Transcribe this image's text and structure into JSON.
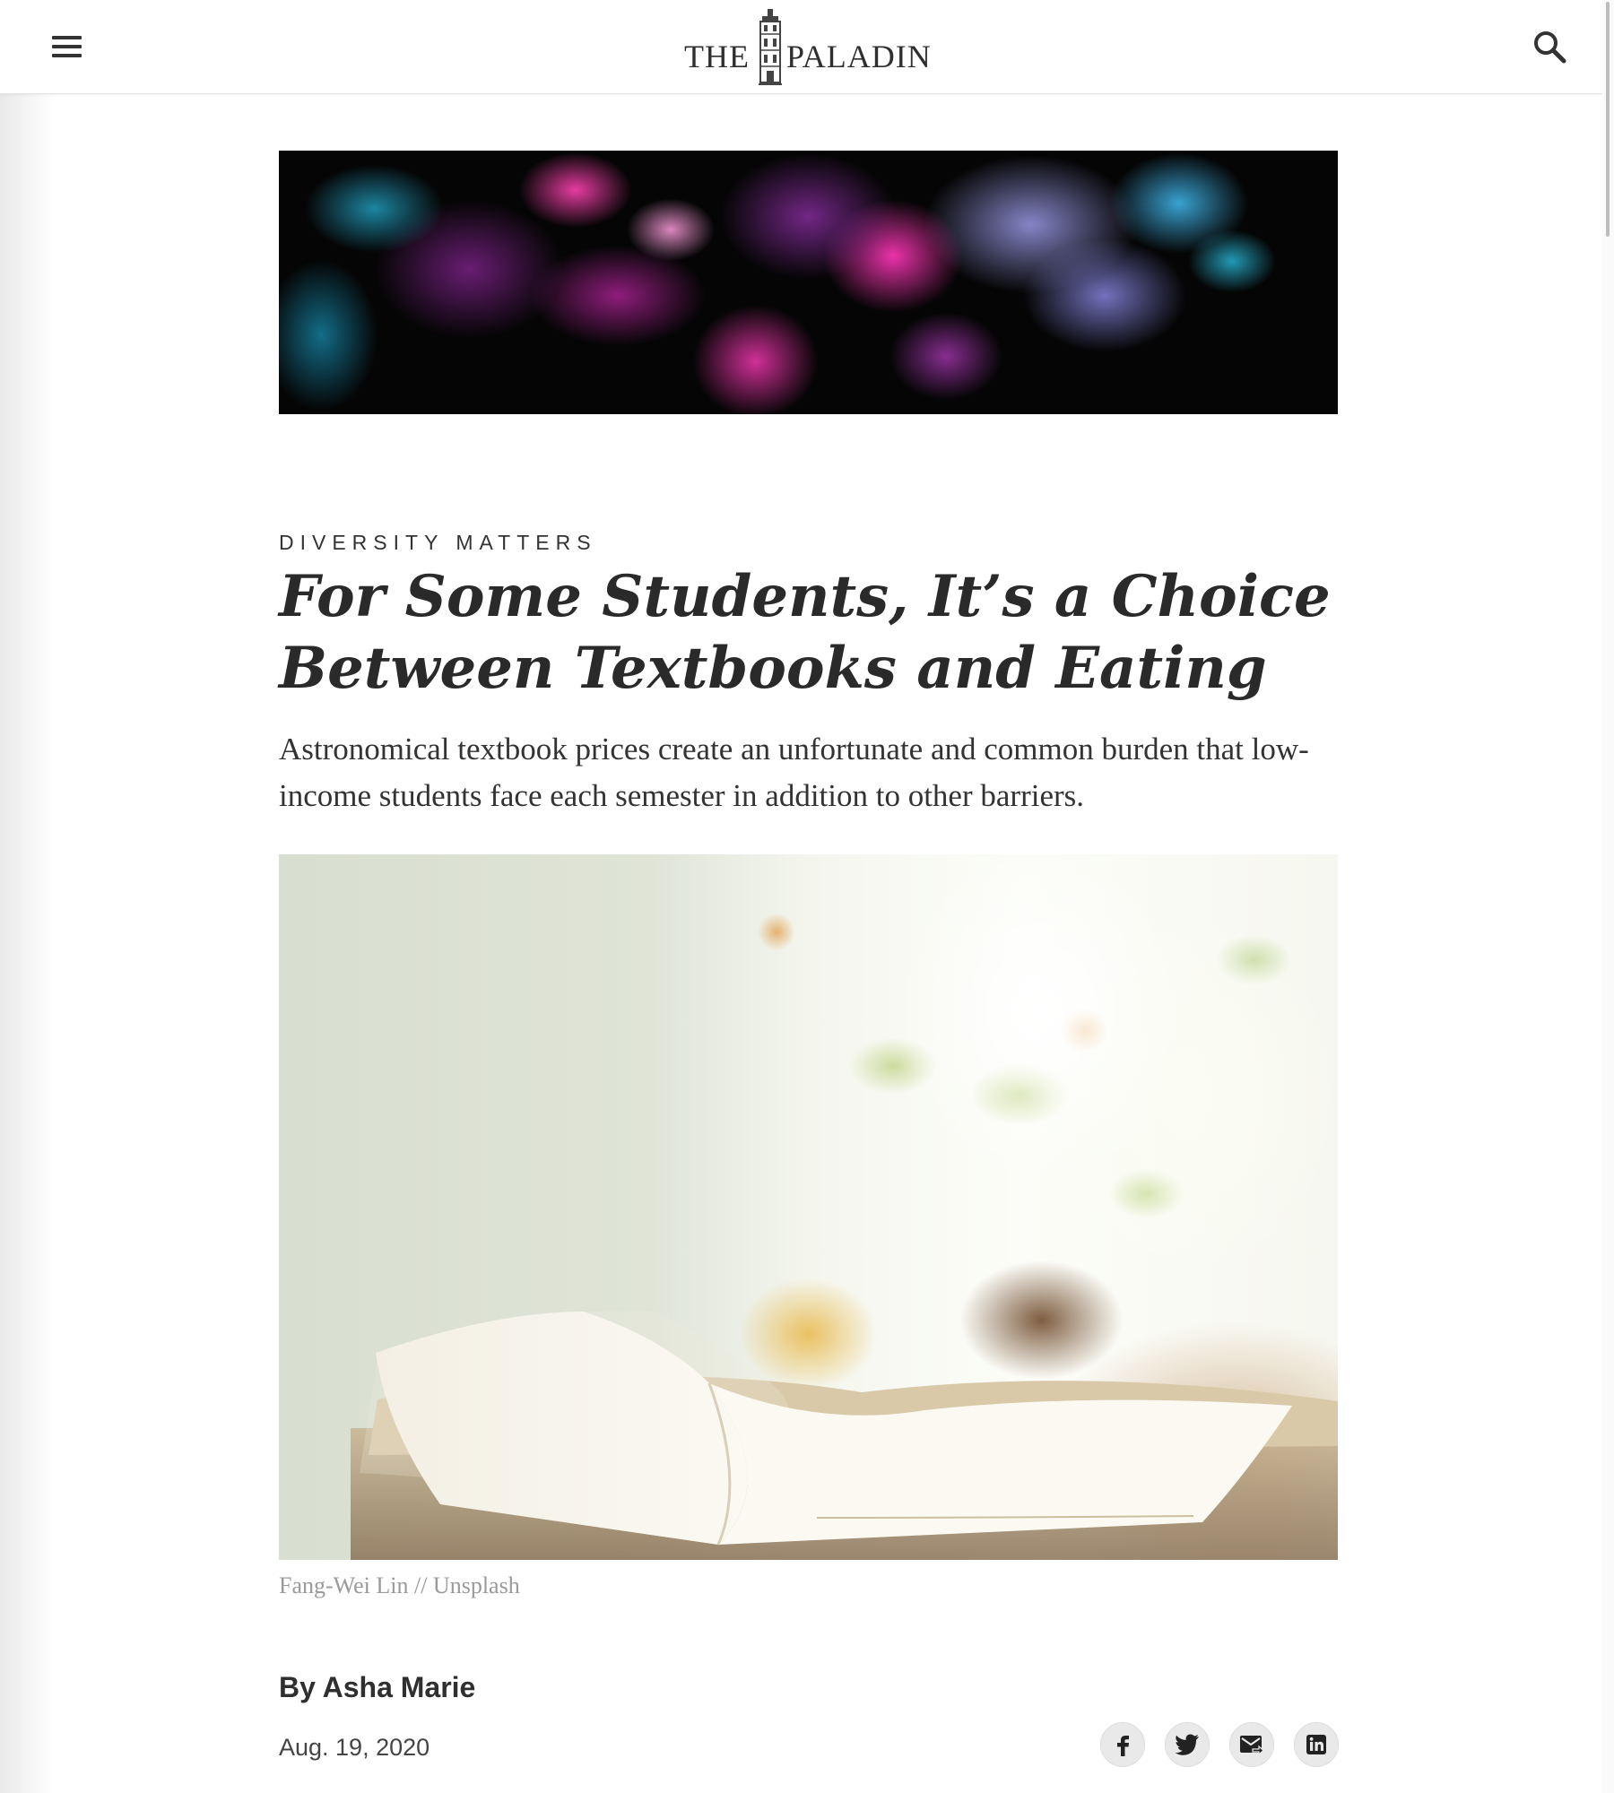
{
  "header": {
    "logo_the": "THE",
    "logo_paladin": "PALADIN",
    "menu_icon": "hamburger-menu-icon",
    "search_icon": "search-icon"
  },
  "hero_image": {
    "description_icon": "abstract-ink-cloud-banner"
  },
  "article": {
    "kicker": "DIVERSITY MATTERS",
    "headline": "For Some Students, It’s a Choice Between Textbooks and Eating",
    "dek": "Astronomical textbook prices create an unfortunate and common burden that low-income students face each semester in addition to other barriers.",
    "photo_caption": "Fang-Wei Lin // Unsplash",
    "byline": "By Asha Marie",
    "date": "Aug. 19, 2020"
  },
  "share": {
    "facebook_icon": "facebook-icon",
    "twitter_icon": "twitter-icon",
    "email_icon": "email-share-icon",
    "linkedin_icon": "linkedin-icon"
  },
  "colors": {
    "text": "#2a2a2a",
    "caption": "#9a9a9a",
    "share_bg": "#e9e9e9"
  }
}
